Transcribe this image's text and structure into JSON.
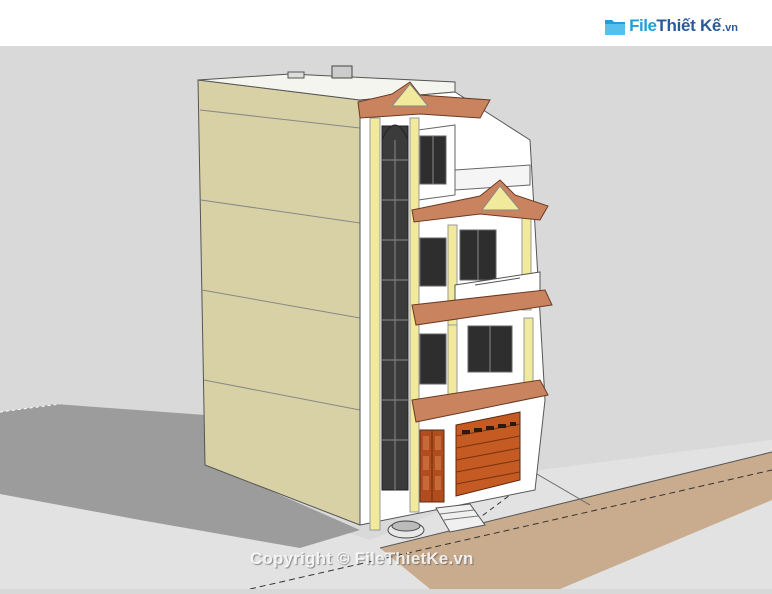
{
  "logo": {
    "brand_part1": "File",
    "brand_part2": "Thiết Kế",
    "brand_tld": ".vn"
  },
  "watermark": {
    "text": "Copyright © FileThietKe.vn"
  },
  "colors": {
    "background": "#d8d8d8",
    "header": "#ffffff",
    "side_wall": "#d6d0a2",
    "front_wall": "#ffffff",
    "roof_tile": "#c9835e",
    "column": "#f1ea9d",
    "door_wood": "#b14d1c",
    "ground": "#c9ab8e",
    "shadow": "#9b9b9b"
  }
}
